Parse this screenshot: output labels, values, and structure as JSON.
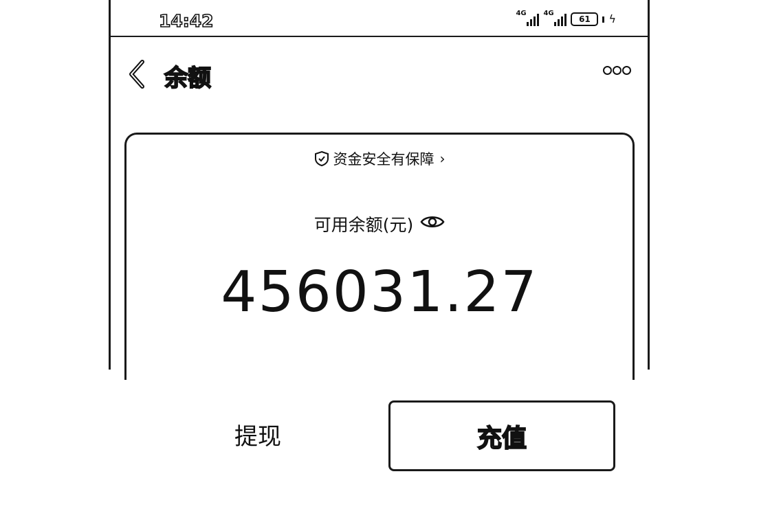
{
  "status_bar": {
    "time": "14:42",
    "signal_1_tag": "4G",
    "signal_2_tag": "4G",
    "battery_level": "61",
    "icons": [
      "signal-icon",
      "signal-icon",
      "battery-icon",
      "charging-icon"
    ]
  },
  "navbar": {
    "title": "余额",
    "back_icon": "chevron-left-icon",
    "more_icon": "more-icon"
  },
  "balance_card": {
    "safety_text": "资金安全有保障",
    "safety_chevron": "›",
    "label": "可用余额(元)",
    "eye_icon": "eye-icon",
    "amount": "456031.27"
  },
  "actions": {
    "withdraw_label": "提现",
    "recharge_label": "充值"
  }
}
